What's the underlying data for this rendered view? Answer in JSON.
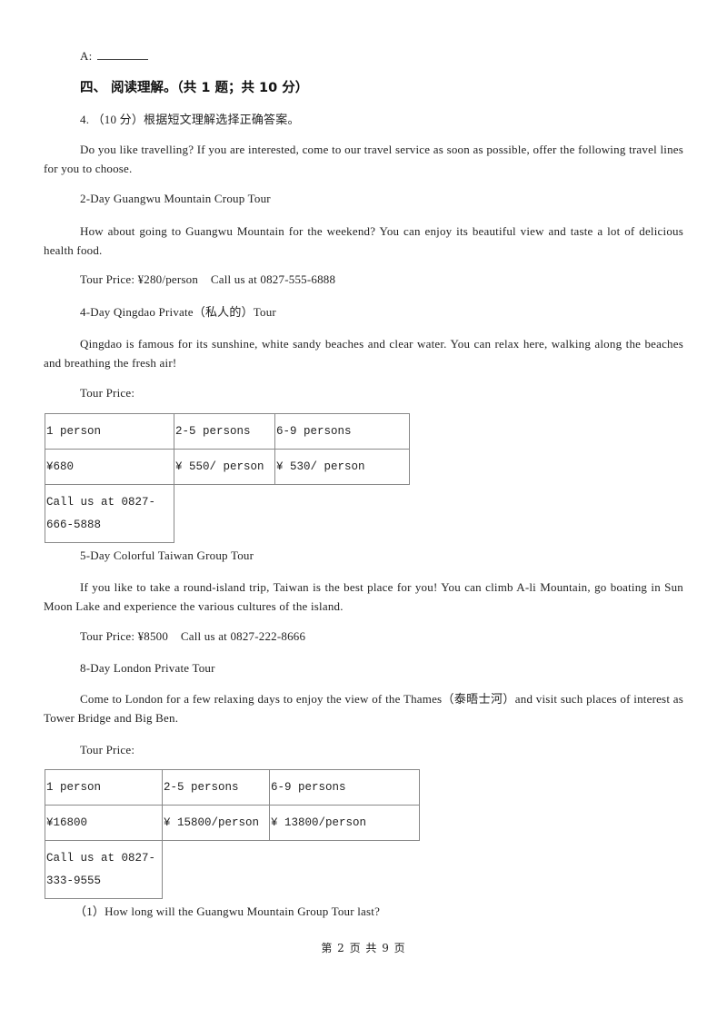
{
  "answer_prefix": "A:",
  "section_heading": "四、  阅读理解。（共 1 题；共 10 分）",
  "question_intro": "4.  （10 分）根据短文理解选择正确答案。",
  "intro_paragraph": "Do you like travelling? If you are interested, come to our travel service as soon as possible, offer the following travel lines for you to choose.",
  "tours": [
    {
      "title": "2-Day Guangwu Mountain Croup Tour",
      "description": "How about going to Guangwu Mountain for the weekend? You can enjoy its beautiful view and taste a lot of delicious health food.",
      "price_line": "Tour Price: ¥280/person    Call us at 0827-555-6888"
    },
    {
      "title": "4-Day Qingdao Private（私人的）Tour",
      "description": "Qingdao is famous for its sunshine, white sandy beaches and clear water. You can relax here, walking along the beaches and breathing the fresh air!",
      "price_label": "Tour Price:",
      "price_table": {
        "headers": [
          "1 person",
          "2-5 persons",
          "6-9 persons"
        ],
        "prices": [
          "¥680",
          "¥ 550/ person",
          "¥ 530/ person"
        ],
        "contact_line1": "Call us at 0827-",
        "contact_line2": "666-5888"
      }
    },
    {
      "title": "5-Day Colorful Taiwan Group Tour",
      "description": "If you like to take a round-island trip, Taiwan is the best place for you! You can climb A-li Mountain, go boating in Sun Moon Lake and experience the various cultures of the island.",
      "price_line": "Tour Price: ¥8500    Call us at 0827-222-8666"
    },
    {
      "title": "8-Day London Private Tour",
      "description": "Come to London for a few relaxing days to enjoy the view of the Thames（泰晤士河）and visit such places of interest as Tower Bridge and Big Ben.",
      "price_label": "Tour Price:",
      "price_table": {
        "headers": [
          "1 person",
          "2-5 persons",
          "6-9 persons"
        ],
        "prices": [
          "¥16800",
          "¥ 15800/person",
          "¥ 13800/person"
        ],
        "contact_line1": "Call us at 0827-",
        "contact_line2": "333-9555"
      }
    }
  ],
  "sub_question": "（1）How long will the Guangwu Mountain Group Tour last?",
  "footer": "第 2 页 共 9 页"
}
